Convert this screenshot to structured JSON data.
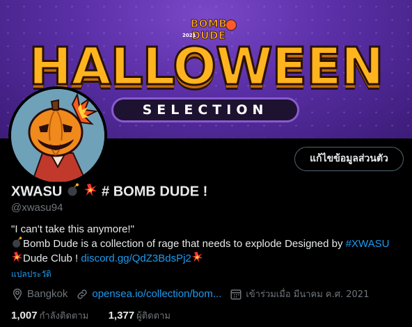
{
  "banner": {
    "logo_year": "2021",
    "logo_line1": "BOMB",
    "logo_line2": "DUDE",
    "headline": "HALLOWEEN",
    "subheadline": "SELECTION"
  },
  "profile": {
    "edit_button": "แก้ไขข้อมูลส่วนตัว",
    "display_name": "XWASU",
    "display_name_suffix": "# BOMB DUDE !",
    "handle": "@xwasu94",
    "bio": {
      "line1": "\"I can't take this anymore!\"",
      "line2_text": "Bomb Dude is a collection of rage that needs to explode Designed by ",
      "line2_hashtag": "#XWASU",
      "line3_text": "Dude Club ! ",
      "line3_link": "discord.gg/QdZ3BdsPj2"
    },
    "translate_label": "แปลประวัติ",
    "location": "Bangkok",
    "website": "opensea.io/collection/bom...",
    "joined": "เข้าร่วมเมื่อ มีนาคม ค.ศ. 2021",
    "following_count": "1,007",
    "following_label": "กำลังติดตาม",
    "followers_count": "1,377",
    "followers_label": "ผู้ติดตาม"
  },
  "icons": [
    "bomb-emoji-icon",
    "collision-emoji-icon",
    "location-pin-icon",
    "link-icon",
    "calendar-icon"
  ],
  "colors": {
    "accent": "#1d9bf0",
    "muted": "#71767b",
    "text": "#e7e9ea",
    "background": "#000000"
  }
}
